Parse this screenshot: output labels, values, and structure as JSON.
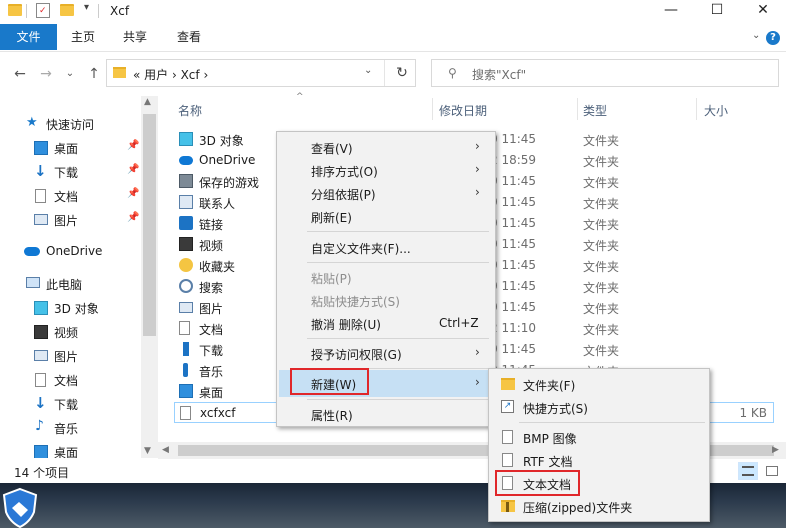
{
  "window": {
    "title": "Xcf",
    "minimize": "—",
    "maximize": "☐",
    "close": "✕"
  },
  "ribbon": {
    "file": "文件",
    "tabs": [
      "主页",
      "共享",
      "查看"
    ],
    "help": "?"
  },
  "address": {
    "path": "«  用户  ›  Xcf  ›",
    "search_placeholder": "搜索\"Xcf\""
  },
  "nav": {
    "quick_access": "快速访问",
    "quick_items": [
      "桌面",
      "下载",
      "文档",
      "图片"
    ],
    "onedrive": "OneDrive",
    "this_pc": "此电脑",
    "pc_items": [
      "3D 对象",
      "视频",
      "图片",
      "文档",
      "下载",
      "音乐",
      "桌面"
    ]
  },
  "columns": {
    "name": "名称",
    "date": "修改日期",
    "type": "类型",
    "size": "大小"
  },
  "files": [
    {
      "name": "3D 对象",
      "date": "0 11:45",
      "type": "文件夹",
      "size": "",
      "icon": "3d-objects-icon"
    },
    {
      "name": "OneDrive",
      "date": "2 18:59",
      "type": "文件夹",
      "size": "",
      "icon": "onedrive-icon"
    },
    {
      "name": "保存的游戏",
      "date": "0 11:45",
      "type": "文件夹",
      "size": "",
      "icon": "saved-games-icon"
    },
    {
      "name": "联系人",
      "date": "0 11:45",
      "type": "文件夹",
      "size": "",
      "icon": "contacts-icon"
    },
    {
      "name": "链接",
      "date": "0 11:45",
      "type": "文件夹",
      "size": "",
      "icon": "links-icon"
    },
    {
      "name": "视频",
      "date": "0 11:45",
      "type": "文件夹",
      "size": "",
      "icon": "video-icon"
    },
    {
      "name": "收藏夹",
      "date": "0 11:45",
      "type": "文件夹",
      "size": "",
      "icon": "favorites-icon"
    },
    {
      "name": "搜索",
      "date": "0 11:45",
      "type": "文件夹",
      "size": "",
      "icon": "search-icon"
    },
    {
      "name": "图片",
      "date": "0 11:45",
      "type": "文件夹",
      "size": "",
      "icon": "pictures-icon"
    },
    {
      "name": "文档",
      "date": "2 11:10",
      "type": "文件夹",
      "size": "",
      "icon": "documents-icon"
    },
    {
      "name": "下载",
      "date": "0 11:45",
      "type": "文件夹",
      "size": "",
      "icon": "downloads-icon"
    },
    {
      "name": "音乐",
      "date": "0 11:45",
      "type": "文件夹",
      "size": "",
      "icon": "music-icon"
    },
    {
      "name": "桌面",
      "date": "0 11:45",
      "type": "文件夹",
      "size": "",
      "icon": "desktop-icon"
    },
    {
      "name": "xcfxcf",
      "date": "",
      "type": "",
      "size": "1 KB",
      "icon": "text-file-icon"
    }
  ],
  "status": {
    "count": "14 个项目"
  },
  "context_menu": {
    "view": "查看(V)",
    "sort": "排序方式(O)",
    "group": "分组依据(P)",
    "refresh": "刷新(E)",
    "customize": "自定义文件夹(F)...",
    "paste": "粘贴(P)",
    "paste_shortcut": "粘贴快捷方式(S)",
    "undo": "撤消 删除(U)",
    "undo_shortcut": "Ctrl+Z",
    "grant_access": "授予访问权限(G)",
    "new": "新建(W)",
    "properties": "属性(R)"
  },
  "new_submenu": {
    "folder": "文件夹(F)",
    "shortcut": "快捷方式(S)",
    "bmp": "BMP 图像",
    "rtf": "RTF 文档",
    "text": "文本文档",
    "zip": "压缩(zipped)文件夹"
  },
  "colors": {
    "accent": "#1979ca",
    "highlight_box": "#e0272a",
    "menu_bg": "#f2f2f2",
    "folder": "#f6c544"
  }
}
